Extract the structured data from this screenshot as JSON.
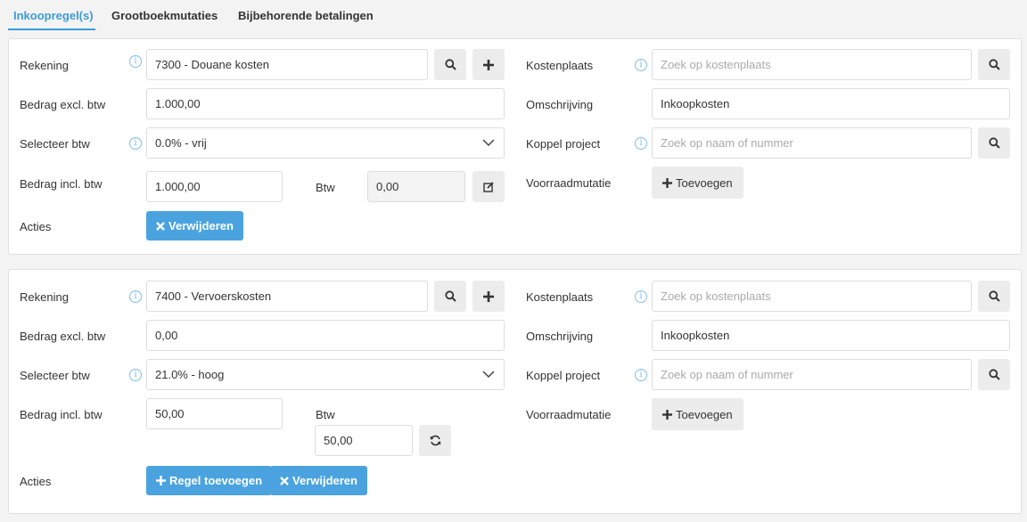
{
  "tabs": [
    {
      "label": "Inkoopregel(s)",
      "active": true
    },
    {
      "label": "Grootboekmutaties",
      "active": false
    },
    {
      "label": "Bijbehorende betalingen",
      "active": false
    }
  ],
  "colors": {
    "accent": "#3a9bd8",
    "button_blue": "#4aa3df"
  },
  "lines": [
    {
      "rekening_label": "Rekening",
      "rekening_value": "7300 - Douane kosten",
      "bedrag_excl_label": "Bedrag excl. btw",
      "bedrag_excl_value": "1.000,00",
      "btw_select_label": "Selecteer btw",
      "btw_select_value": "0.0% - vrij",
      "bedrag_incl_label": "Bedrag incl. btw",
      "bedrag_incl_value": "1.000,00",
      "btw_label": "Btw",
      "btw_value": "0,00",
      "acties_label": "Acties",
      "delete_label": "Verwijderen",
      "kostenplaats_label": "Kostenplaats",
      "kostenplaats_placeholder": "Zoek op kostenplaats",
      "omschrijving_label": "Omschrijving",
      "omschrijving_value": "Inkoopkosten",
      "project_label": "Koppel project",
      "project_placeholder": "Zoek op naam of nummer",
      "voorraad_label": "Voorraadmutatie",
      "voorraad_button": "Toevoegen"
    },
    {
      "rekening_label": "Rekening",
      "rekening_value": "7400 - Vervoerskosten",
      "bedrag_excl_label": "Bedrag excl. btw",
      "bedrag_excl_value": "0,00",
      "btw_select_label": "Selecteer btw",
      "btw_select_value": "21.0% - hoog",
      "bedrag_incl_label": "Bedrag incl. btw",
      "bedrag_incl_value": "50,00",
      "btw_label": "Btw",
      "btw_value": "50,00",
      "acties_label": "Acties",
      "add_line_label": "Regel toevoegen",
      "delete_label": "Verwijderen",
      "kostenplaats_label": "Kostenplaats",
      "kostenplaats_placeholder": "Zoek op kostenplaats",
      "omschrijving_label": "Omschrijving",
      "omschrijving_value": "Inkoopkosten",
      "project_label": "Koppel project",
      "project_placeholder": "Zoek op naam of nummer",
      "voorraad_label": "Voorraadmutatie",
      "voorraad_button": "Toevoegen"
    }
  ]
}
